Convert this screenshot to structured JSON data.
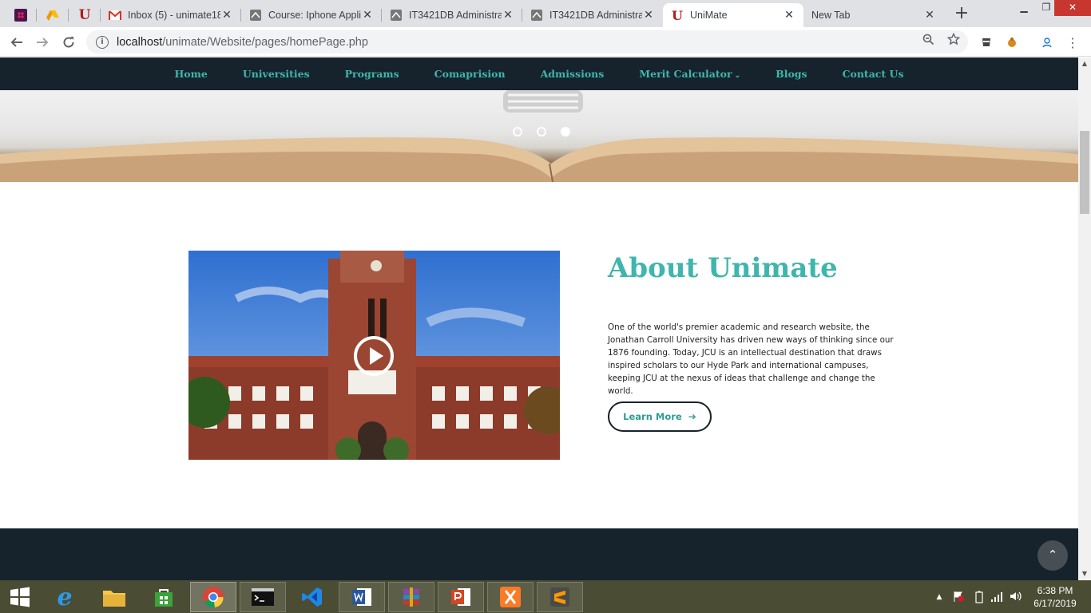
{
  "browser": {
    "tabs": [
      {
        "title": "Inbox (5) - unimate18",
        "icon": "gmail-icon"
      },
      {
        "title": "Course: Iphone Appli",
        "icon": "moodle-icon"
      },
      {
        "title": "IT3421DB Administra",
        "icon": "moodle-icon"
      },
      {
        "title": "IT3421DB Administra",
        "icon": "moodle-icon"
      },
      {
        "title": "UniMate",
        "icon": "unimate-icon",
        "active": true
      },
      {
        "title": "New Tab",
        "icon": ""
      }
    ],
    "url_host": "localhost",
    "url_path": "/unimate/Website/pages/homePage.php"
  },
  "nav": {
    "items": [
      "Home",
      "Universities",
      "Programs",
      "Comaprision",
      "Admissions",
      "Merit Calculator",
      "Blogs",
      "Contact Us"
    ]
  },
  "about": {
    "title": "About Unimate",
    "text": "One of the world's premier academic and research website, the Jonathan Carroll University has driven new ways of thinking since our 1876 founding. Today, JCU is an intellectual destination that draws inspired scholars to our Hyde Park and international campuses, keeping JCU at the nexus of ideas that challenge and change the world.",
    "button_label": "Learn More"
  },
  "taskbar": {
    "time": "6:38 PM",
    "date": "6/17/2019"
  },
  "colors": {
    "accent": "#3fb6ad",
    "navbar_bg": "#16232c",
    "taskbar_bg": "#4b4c34"
  }
}
